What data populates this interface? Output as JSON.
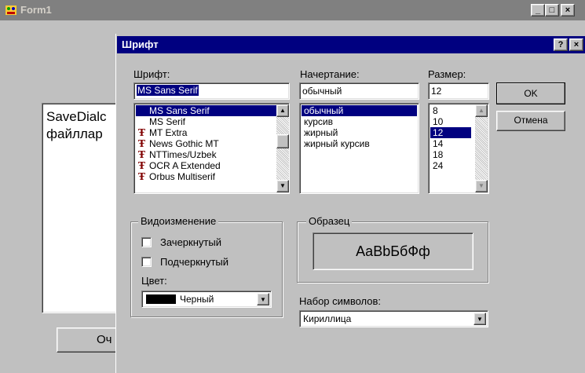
{
  "form1": {
    "title": "Form1",
    "memo_lines": [
      "SaveDialc",
      "файллар"
    ],
    "button_label_partial": "Оч"
  },
  "dialog": {
    "title": "Шрифт",
    "font_label": "Шрифт:",
    "font_value": "MS Sans Serif",
    "font_list": [
      {
        "name": "MS Sans Serif",
        "tt": false,
        "selected": true
      },
      {
        "name": "MS Serif",
        "tt": false,
        "selected": false
      },
      {
        "name": "MT Extra",
        "tt": true,
        "selected": false
      },
      {
        "name": "News Gothic MT",
        "tt": true,
        "selected": false
      },
      {
        "name": "NTTimes/Uzbek",
        "tt": true,
        "selected": false
      },
      {
        "name": "OCR A Extended",
        "tt": true,
        "selected": false
      },
      {
        "name": "Orbus Multiserif",
        "tt": true,
        "selected": false
      }
    ],
    "style_label": "Начертание:",
    "style_value": "обычный",
    "style_list": [
      "обычный",
      "курсив",
      "жирный",
      "жирный курсив"
    ],
    "size_label": "Размер:",
    "size_value": "12",
    "size_list": [
      "8",
      "10",
      "12",
      "14",
      "18",
      "24"
    ],
    "ok_label": "OK",
    "cancel_label": "Отмена",
    "effects_label": "Видоизменение",
    "strikeout_label": "Зачеркнутый",
    "underline_label": "Подчеркнутый",
    "color_label": "Цвет:",
    "color_value": "Черный",
    "sample_label": "Образец",
    "sample_text": "AaBbБбФф",
    "charset_label": "Набор символов:",
    "charset_value": "Кириллица"
  },
  "colors": {
    "titlebar_active": "#000080",
    "titlebar_inactive": "#808080",
    "face": "#c0c0c0"
  }
}
